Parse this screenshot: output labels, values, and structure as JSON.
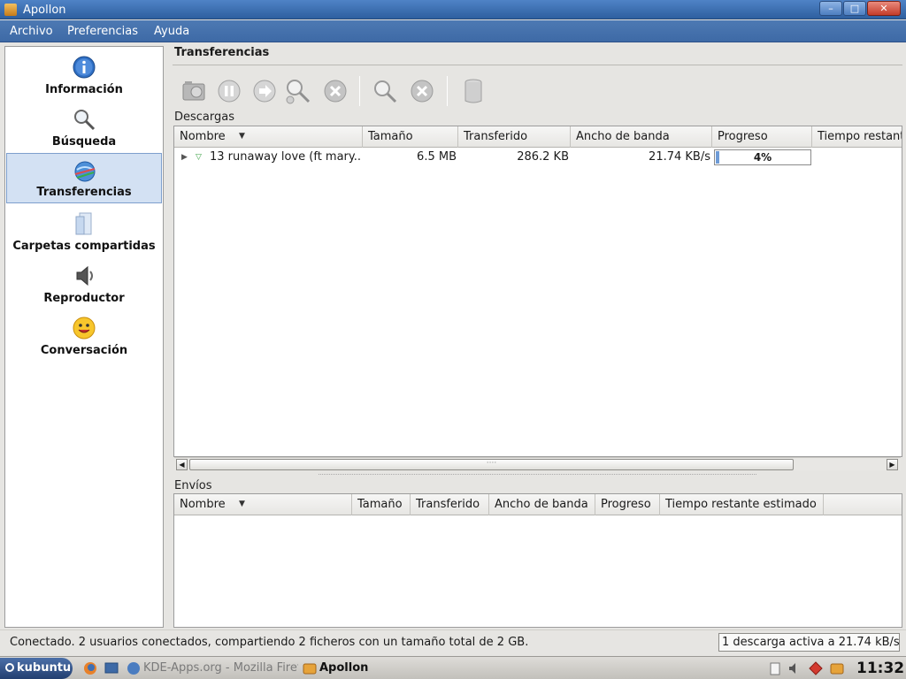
{
  "window": {
    "title": "Apollon",
    "minimize_glyph": "–",
    "maximize_glyph": "□",
    "close_glyph": "✕"
  },
  "menubar": {
    "items": [
      {
        "label": "Archivo"
      },
      {
        "label": "Preferencias"
      },
      {
        "label": "Ayuda"
      }
    ]
  },
  "sidebar": {
    "items": [
      {
        "label": "Información",
        "icon": "info-icon"
      },
      {
        "label": "Búsqueda",
        "icon": "magnifier-icon"
      },
      {
        "label": "Transferencias",
        "icon": "transfer-globe-icon",
        "active": true
      },
      {
        "label": "Carpetas compartidas",
        "icon": "shared-folder-icon"
      },
      {
        "label": "Reproductor",
        "icon": "speaker-icon"
      },
      {
        "label": "Conversación",
        "icon": "smiley-icon"
      }
    ]
  },
  "main": {
    "title": "Transferencias",
    "toolbar": [
      {
        "icon": "clean-icon"
      },
      {
        "icon": "pause-icon"
      },
      {
        "icon": "resume-icon"
      },
      {
        "icon": "search-sources-icon"
      },
      {
        "icon": "cancel-icon"
      },
      {
        "icon": "search-icon"
      },
      {
        "icon": "remove-icon"
      },
      {
        "icon": "trash-icon"
      }
    ],
    "downloads": {
      "label": "Descargas",
      "columns": [
        "Nombre",
        "Tamaño",
        "Transferido",
        "Ancho de banda",
        "Progreso",
        "Tiempo restant"
      ],
      "rows": [
        {
          "name": "13 runaway love (ft mary...",
          "size": "6.5 MB",
          "transferred": "286.2 KB",
          "bandwidth": "21.74 KB/s",
          "progress": 4,
          "progress_text": "4%"
        }
      ]
    },
    "uploads": {
      "label": "Envíos",
      "columns": [
        "Nombre",
        "Tamaño",
        "Transferido",
        "Ancho de banda",
        "Progreso",
        "Tiempo restante estimado"
      ]
    }
  },
  "statusbar": {
    "text": "Conectado. 2 usuarios conectados, compartiendo 2 ficheros con un tamaño total de 2 GB.",
    "right": "1 descarga activa a 21.74 kB/s"
  },
  "taskbar": {
    "start_label": "kubuntu",
    "tasks": [
      {
        "label": "KDE-Apps.org - Mozilla Firef",
        "active": false
      },
      {
        "label": "Apollon",
        "active": true
      }
    ],
    "clock": "11:32"
  },
  "colors": {
    "titlebar": "#3e6aa6",
    "selection": "#d3e1f3",
    "progress_fill": "#6e9bd6"
  }
}
